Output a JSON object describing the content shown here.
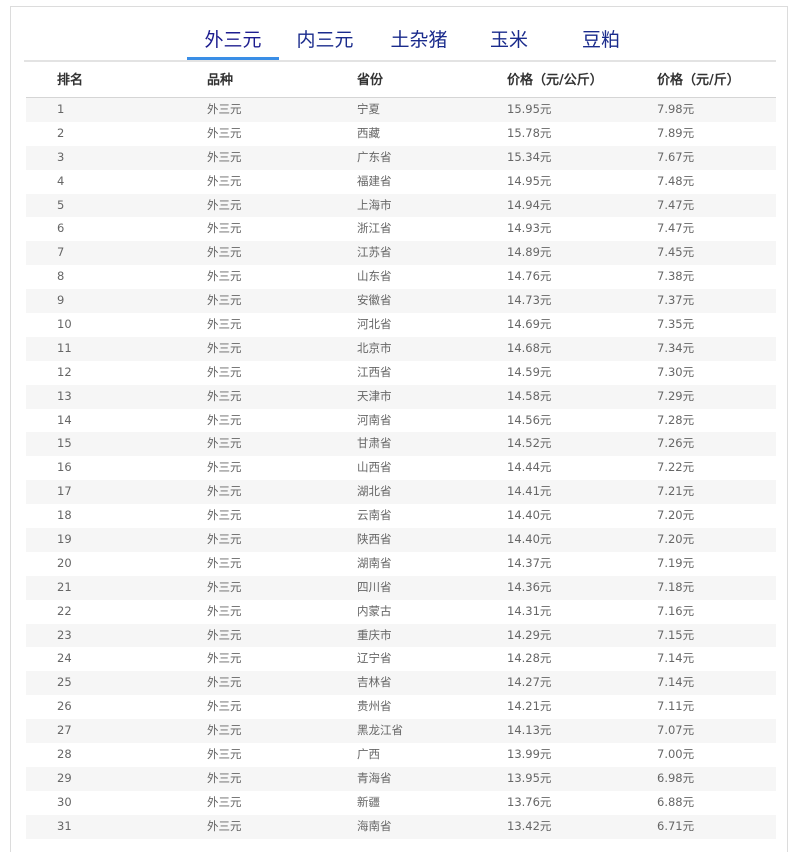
{
  "tabs": [
    {
      "label": "外三元",
      "active": true
    },
    {
      "label": "内三元",
      "active": false
    },
    {
      "label": "土杂猪",
      "active": false
    },
    {
      "label": "玉米",
      "active": false
    },
    {
      "label": "豆粕",
      "active": false
    }
  ],
  "table": {
    "headers": {
      "rank": "排名",
      "kind": "品种",
      "province": "省份",
      "price_kg": "价格（元/公斤）",
      "price_jin": "价格（元/斤）"
    },
    "rows": [
      {
        "rank": "1",
        "kind": "外三元",
        "province": "宁夏",
        "price_kg": "15.95元",
        "price_jin": "7.98元"
      },
      {
        "rank": "2",
        "kind": "外三元",
        "province": "西藏",
        "price_kg": "15.78元",
        "price_jin": "7.89元"
      },
      {
        "rank": "3",
        "kind": "外三元",
        "province": "广东省",
        "price_kg": "15.34元",
        "price_jin": "7.67元"
      },
      {
        "rank": "4",
        "kind": "外三元",
        "province": "福建省",
        "price_kg": "14.95元",
        "price_jin": "7.48元"
      },
      {
        "rank": "5",
        "kind": "外三元",
        "province": "上海市",
        "price_kg": "14.94元",
        "price_jin": "7.47元"
      },
      {
        "rank": "6",
        "kind": "外三元",
        "province": "浙江省",
        "price_kg": "14.93元",
        "price_jin": "7.47元"
      },
      {
        "rank": "7",
        "kind": "外三元",
        "province": "江苏省",
        "price_kg": "14.89元",
        "price_jin": "7.45元"
      },
      {
        "rank": "8",
        "kind": "外三元",
        "province": "山东省",
        "price_kg": "14.76元",
        "price_jin": "7.38元"
      },
      {
        "rank": "9",
        "kind": "外三元",
        "province": "安徽省",
        "price_kg": "14.73元",
        "price_jin": "7.37元"
      },
      {
        "rank": "10",
        "kind": "外三元",
        "province": "河北省",
        "price_kg": "14.69元",
        "price_jin": "7.35元"
      },
      {
        "rank": "11",
        "kind": "外三元",
        "province": "北京市",
        "price_kg": "14.68元",
        "price_jin": "7.34元"
      },
      {
        "rank": "12",
        "kind": "外三元",
        "province": "江西省",
        "price_kg": "14.59元",
        "price_jin": "7.30元"
      },
      {
        "rank": "13",
        "kind": "外三元",
        "province": "天津市",
        "price_kg": "14.58元",
        "price_jin": "7.29元"
      },
      {
        "rank": "14",
        "kind": "外三元",
        "province": "河南省",
        "price_kg": "14.56元",
        "price_jin": "7.28元"
      },
      {
        "rank": "15",
        "kind": "外三元",
        "province": "甘肃省",
        "price_kg": "14.52元",
        "price_jin": "7.26元"
      },
      {
        "rank": "16",
        "kind": "外三元",
        "province": "山西省",
        "price_kg": "14.44元",
        "price_jin": "7.22元"
      },
      {
        "rank": "17",
        "kind": "外三元",
        "province": "湖北省",
        "price_kg": "14.41元",
        "price_jin": "7.21元"
      },
      {
        "rank": "18",
        "kind": "外三元",
        "province": "云南省",
        "price_kg": "14.40元",
        "price_jin": "7.20元"
      },
      {
        "rank": "19",
        "kind": "外三元",
        "province": "陕西省",
        "price_kg": "14.40元",
        "price_jin": "7.20元"
      },
      {
        "rank": "20",
        "kind": "外三元",
        "province": "湖南省",
        "price_kg": "14.37元",
        "price_jin": "7.19元"
      },
      {
        "rank": "21",
        "kind": "外三元",
        "province": "四川省",
        "price_kg": "14.36元",
        "price_jin": "7.18元"
      },
      {
        "rank": "22",
        "kind": "外三元",
        "province": "内蒙古",
        "price_kg": "14.31元",
        "price_jin": "7.16元"
      },
      {
        "rank": "23",
        "kind": "外三元",
        "province": "重庆市",
        "price_kg": "14.29元",
        "price_jin": "7.15元"
      },
      {
        "rank": "24",
        "kind": "外三元",
        "province": "辽宁省",
        "price_kg": "14.28元",
        "price_jin": "7.14元"
      },
      {
        "rank": "25",
        "kind": "外三元",
        "province": "吉林省",
        "price_kg": "14.27元",
        "price_jin": "7.14元"
      },
      {
        "rank": "26",
        "kind": "外三元",
        "province": "贵州省",
        "price_kg": "14.21元",
        "price_jin": "7.11元"
      },
      {
        "rank": "27",
        "kind": "外三元",
        "province": "黑龙江省",
        "price_kg": "14.13元",
        "price_jin": "7.07元"
      },
      {
        "rank": "28",
        "kind": "外三元",
        "province": "广西",
        "price_kg": "13.99元",
        "price_jin": "7.00元"
      },
      {
        "rank": "29",
        "kind": "外三元",
        "province": "青海省",
        "price_kg": "13.95元",
        "price_jin": "6.98元"
      },
      {
        "rank": "30",
        "kind": "外三元",
        "province": "新疆",
        "price_kg": "13.76元",
        "price_jin": "6.88元"
      },
      {
        "rank": "31",
        "kind": "外三元",
        "province": "海南省",
        "price_kg": "13.42元",
        "price_jin": "6.71元"
      }
    ]
  }
}
